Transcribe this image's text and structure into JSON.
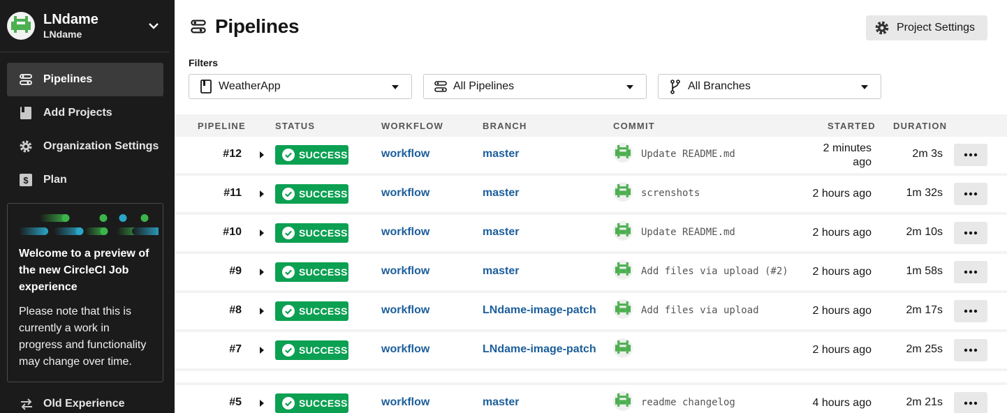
{
  "sidebar": {
    "org_name": "LNdame",
    "org_sub": "LNdame",
    "nav": [
      {
        "label": "Pipelines",
        "icon": "pipelines-icon",
        "active": true
      },
      {
        "label": "Add Projects",
        "icon": "book-icon"
      },
      {
        "label": "Organization Settings",
        "icon": "gear-icon"
      },
      {
        "label": "Plan",
        "icon": "dollar-icon"
      }
    ],
    "welcome_title": "Welcome to a preview of the new CircleCI Job  experience",
    "welcome_body": "Please note that this is  currently a work in  progress and functionality may change over time.",
    "old_experience": "Old Experience"
  },
  "header": {
    "title": "Pipelines",
    "project_settings": "Project Settings"
  },
  "filters": {
    "label": "Filters",
    "project": "WeatherApp",
    "pipelines": "All Pipelines",
    "branches": "All Branches"
  },
  "table": {
    "headers": [
      "PIPELINE",
      "STATUS",
      "WORKFLOW",
      "BRANCH",
      "COMMIT",
      "STARTED",
      "DURATION"
    ],
    "rows": [
      {
        "num": "#12",
        "status": "SUCCESS",
        "workflow": "workflow",
        "branch": "master",
        "commit": "Update README.md",
        "started": "2 minutes ago",
        "duration": "2m 3s"
      },
      {
        "num": "#11",
        "status": "SUCCESS",
        "workflow": "workflow",
        "branch": "master",
        "commit": "screnshots",
        "started": "2 hours ago",
        "duration": "1m 32s"
      },
      {
        "num": "#10",
        "status": "SUCCESS",
        "workflow": "workflow",
        "branch": "master",
        "commit": "Update README.md",
        "started": "2 hours ago",
        "duration": "2m 10s"
      },
      {
        "num": "#9",
        "status": "SUCCESS",
        "workflow": "workflow",
        "branch": "master",
        "commit": "Add files via upload (#2)",
        "started": "2 hours ago",
        "duration": "1m 58s"
      },
      {
        "num": "#8",
        "status": "SUCCESS",
        "workflow": "workflow",
        "branch": "LNdame-image-patch",
        "commit": "Add files via upload",
        "started": "2 hours ago",
        "duration": "2m 17s"
      },
      {
        "num": "#7",
        "status": "SUCCESS",
        "workflow": "workflow",
        "branch": "LNdame-image-patch",
        "commit": "",
        "started": "2 hours ago",
        "duration": "2m 25s"
      },
      {
        "num": "#5",
        "status": "SUCCESS",
        "workflow": "workflow",
        "branch": "master",
        "commit": "readme changelog",
        "started": "4 hours ago",
        "duration": "2m 21s"
      }
    ]
  },
  "colors": {
    "sidebar_bg": "#1b1b1b",
    "success": "#0ca052",
    "link": "#1c5e9b",
    "avatar_green": "#4caf50"
  }
}
